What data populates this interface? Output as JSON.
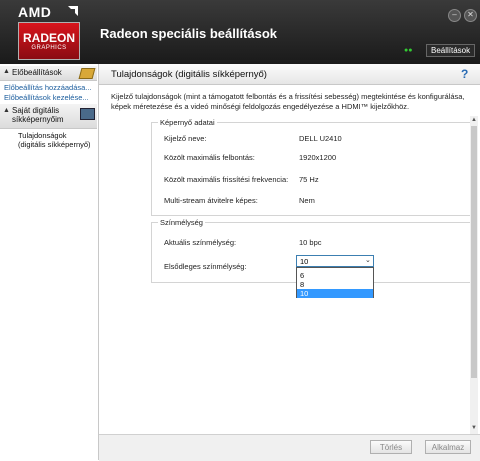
{
  "app": {
    "brand": "AMD",
    "badge_line1": "RADEON",
    "badge_line2": "GRAPHICS",
    "title": "Radeon speciális beállítások",
    "preferences_label": "Beállítások",
    "leds": "●●",
    "minimize_glyph": "–",
    "close_glyph": "✕"
  },
  "sidebar": {
    "presets_header": "Előbeállítások",
    "links": [
      "Előbeállítás hozzáadása...",
      "Előbeállítások kezelése..."
    ],
    "section_header": "Saját digitális síkképernyőim",
    "items": [
      "Tulajdonságok (digitális síkképernyő)"
    ],
    "collapse_glyph": "▲"
  },
  "main": {
    "title": "Tulajdonságok (digitális síkképernyő)",
    "help_glyph": "?",
    "description": "Kijelző tulajdonságok (mint a támogatott felbontás és a frissítési sebesség) megtekintése és konfigurálása, képek méretezése és a videó minőségi feldolgozás engedélyezése a HDMI™ kijelzőkhöz."
  },
  "display_group": {
    "legend": "Képernyő adatai",
    "rows": [
      {
        "label": "Kijelző neve:",
        "value": "DELL U2410"
      },
      {
        "label": "Közölt maximális felbontás:",
        "value": "1920x1200"
      },
      {
        "label": "Közölt maximális frissítési frekvencia:",
        "value": "75 Hz"
      },
      {
        "label": "Multi-stream átvitelre képes:",
        "value": "Nem"
      }
    ]
  },
  "color_group": {
    "legend": "Színmélység",
    "current_label": "Aktuális színmélység:",
    "current_value": "10 bpc",
    "preferred_label": "Elsődleges színmélység:",
    "selected": "10",
    "chevron_glyph": "⌄",
    "options": [
      "6",
      "8",
      "10"
    ]
  },
  "footer": {
    "discard_label": "Törlés",
    "apply_label": "Alkalmaz"
  },
  "scroll_up_glyph": "▲",
  "scroll_down_glyph": "▼",
  "colors": {
    "accent": "#3399ff",
    "brand_red": "#d8141c"
  }
}
